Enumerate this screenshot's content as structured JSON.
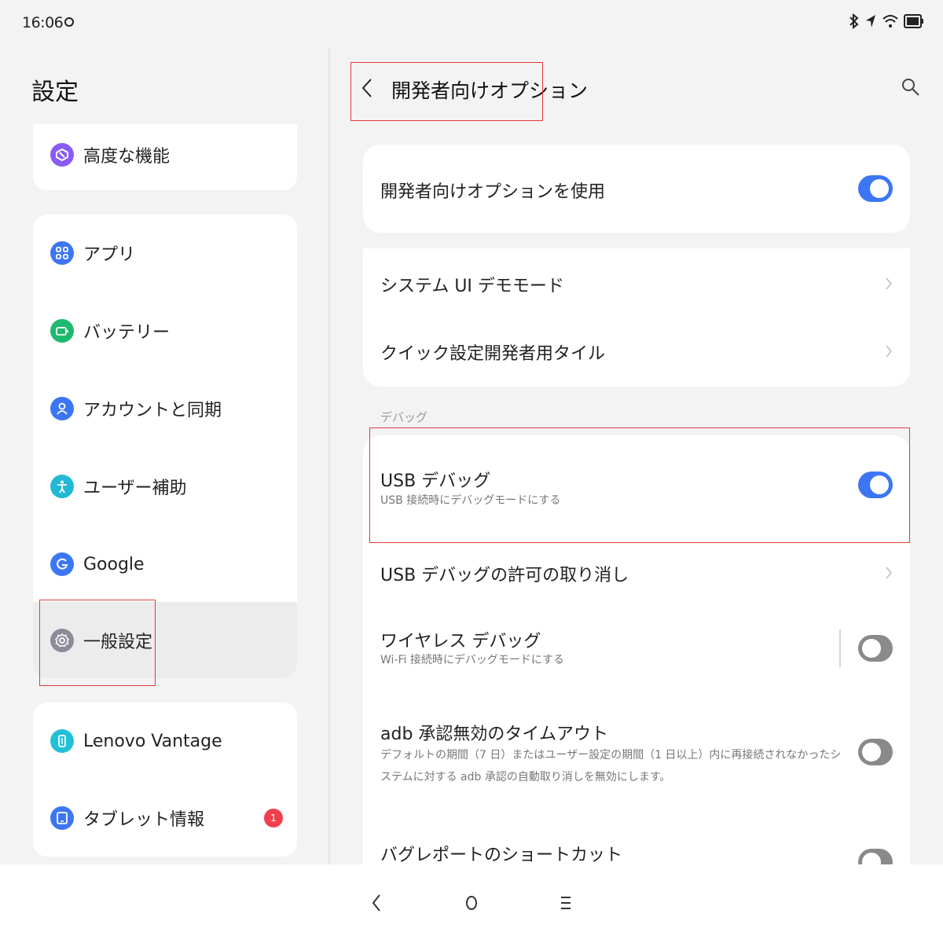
{
  "status_bar": {
    "time": "16:06"
  },
  "left": {
    "title": "設定",
    "items": [
      {
        "label": "高度な機能",
        "icon": "cube-icon",
        "color": "#8a5cf6"
      },
      {
        "label": "アプリ",
        "icon": "apps-grid-icon",
        "color": "#3d76f4"
      },
      {
        "label": "バッテリー",
        "icon": "battery-icon",
        "color": "#1fb86f"
      },
      {
        "label": "アカウントと同期",
        "icon": "person-icon",
        "color": "#3d76f4"
      },
      {
        "label": "ユーザー補助",
        "icon": "accessibility-icon",
        "color": "#22b8d6"
      },
      {
        "label": "Google",
        "icon": "google-icon",
        "color": "#3d76f4"
      },
      {
        "label": "一般設定",
        "icon": "gear-icon",
        "color": "#8c8c99"
      },
      {
        "label": "Lenovo Vantage",
        "icon": "vantage-icon",
        "color": "#22c0d8"
      },
      {
        "label": "タブレット情報",
        "icon": "tablet-icon",
        "color": "#3d76f4",
        "badge": "1"
      }
    ]
  },
  "right": {
    "title": "開発者向けオプション",
    "enable_row": {
      "title": "開発者向けオプションを使用",
      "on": true
    },
    "links": [
      {
        "title": "システム UI デモモード"
      },
      {
        "title": "クイック設定開発者用タイル"
      }
    ],
    "section_label": "デバッグ",
    "debug_rows": [
      {
        "title": "USB デバッグ",
        "subtitle": "USB 接続時にデバッグモードにする",
        "on": true
      },
      {
        "title": "USB デバッグの許可の取り消し"
      },
      {
        "title": "ワイヤレス デバッグ",
        "subtitle": "Wi-Fi 接続時にデバッグモードにする",
        "on": false
      },
      {
        "title": "adb 承認無効のタイムアウト",
        "subtitle": "デフォルトの期間（7 日）またはユーザー設定の期間（1 日以上）内に再接続されなかったシステムに対する adb 承認の自動取り消しを無効にします。",
        "on": false
      },
      {
        "title": "バグレポートのショートカット",
        "on": false
      }
    ]
  },
  "colors": {
    "accent": "#3d76f4",
    "highlight": "#e23a3a",
    "badge": "#f0404e"
  }
}
